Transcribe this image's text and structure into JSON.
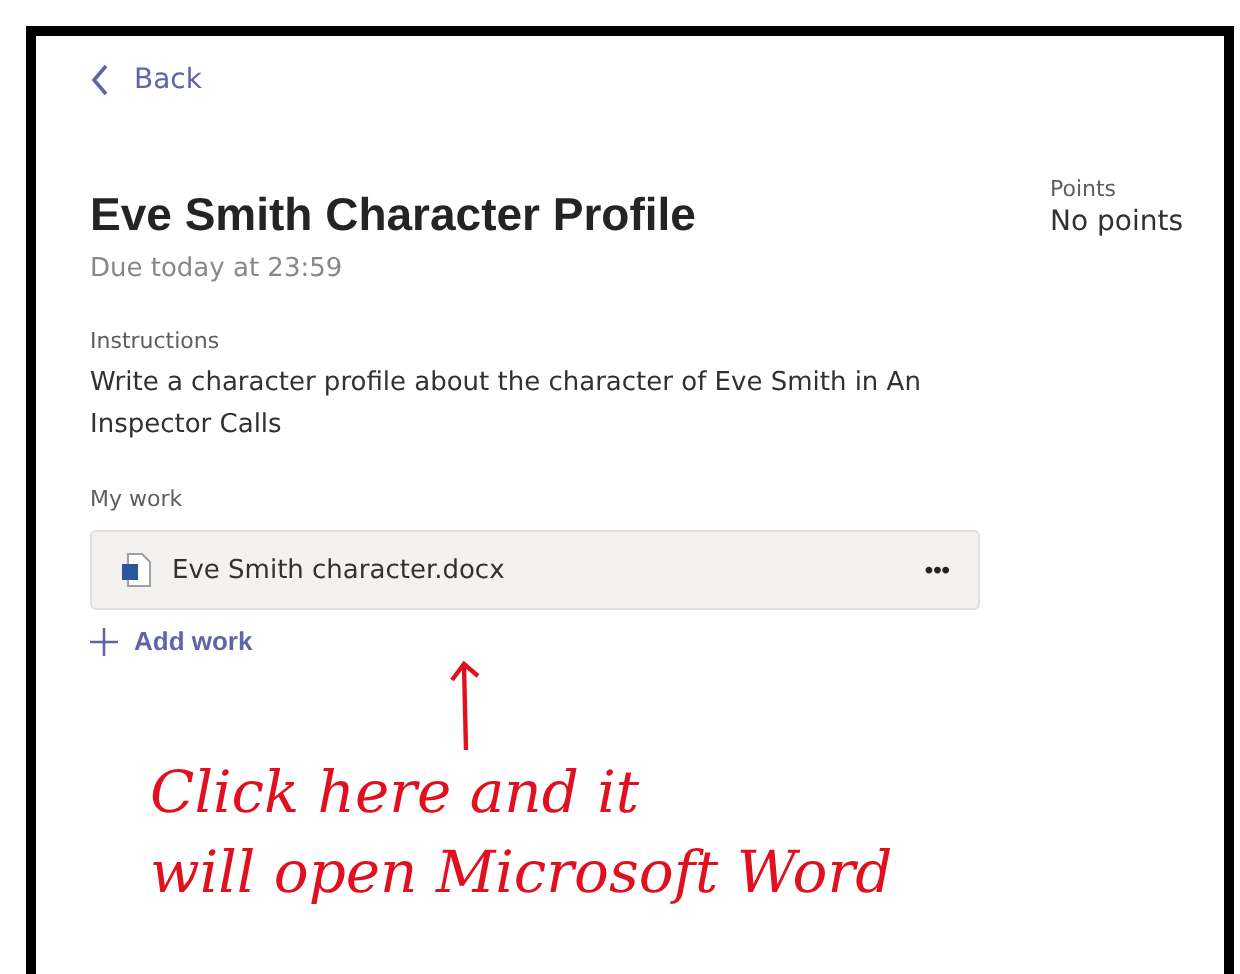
{
  "back_link": {
    "label": "Back"
  },
  "assignment": {
    "title": "Eve Smith Character Profile",
    "due": "Due today at 23:59",
    "instructions_label": "Instructions",
    "instructions": "Write a character profile about the character of Eve Smith in An Inspector Calls"
  },
  "points": {
    "label": "Points",
    "value": "No points"
  },
  "my_work": {
    "label": "My work",
    "files": [
      {
        "name": "Eve Smith character.docx",
        "menu": "•••"
      }
    ],
    "add_label": "Add work"
  },
  "annotation": {
    "lines": [
      "Click here and it",
      "will open Microsoft Word"
    ]
  }
}
